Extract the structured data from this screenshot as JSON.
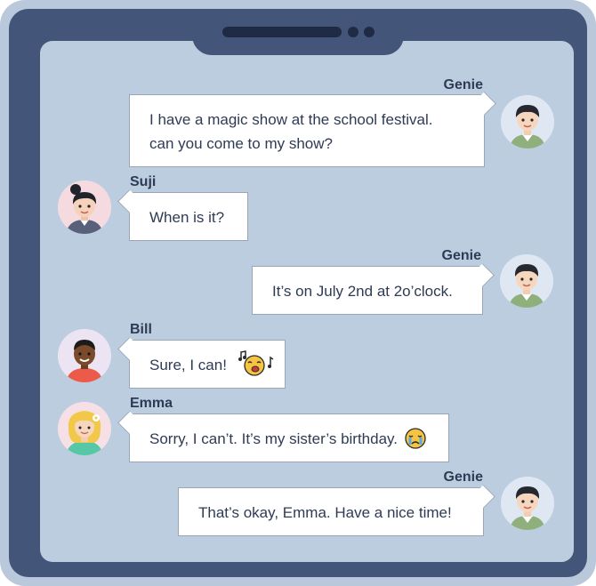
{
  "messages": [
    {
      "sender": "Genie",
      "text_line1": "I have a magic show at the school festival.",
      "text_line2": "can you come to my show?"
    },
    {
      "sender": "Suji",
      "text": "When is it?"
    },
    {
      "sender": "Genie",
      "text": "It’s on July 2nd at 2o’clock."
    },
    {
      "sender": "Bill",
      "text": "Sure, I can!"
    },
    {
      "sender": "Emma",
      "text": "Sorry, I can’t. It’s my sister’s birthday."
    },
    {
      "sender": "Genie",
      "text": "That’s okay, Emma. Have a nice time!"
    }
  ],
  "icons": {
    "genie_avatar": "boy-avatar-green-hoodie",
    "suji_avatar": "girl-avatar-bun-hair",
    "bill_avatar": "boy-avatar-red-shirt",
    "emma_avatar": "girl-avatar-blonde-flower",
    "bill_emoji": "singing-face-emoji",
    "emma_emoji": "crying-face-emoji"
  },
  "colors": {
    "device_frame": "#44557a",
    "device_bezel": "#b9c8db",
    "screen_bg": "#bccde0",
    "bubble_bg": "#ffffff",
    "text": "#2f3b54"
  }
}
